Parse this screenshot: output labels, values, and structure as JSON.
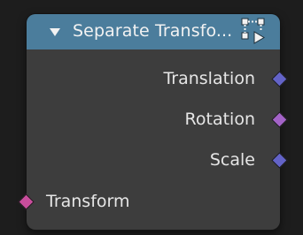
{
  "node": {
    "title": "Separate Transfo...",
    "header_color": "#4b7d9c",
    "collapse_icon": "triangle-down-icon",
    "group_icon": "node-group-icon",
    "outputs": [
      {
        "label": "Translation",
        "socket_color": "#6363c7"
      },
      {
        "label": "Rotation",
        "socket_color": "#a363c7"
      },
      {
        "label": "Scale",
        "socket_color": "#6363c7"
      }
    ],
    "inputs": [
      {
        "label": "Transform",
        "socket_color": "#c94d9c"
      }
    ]
  }
}
